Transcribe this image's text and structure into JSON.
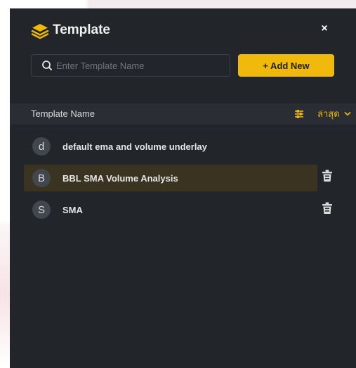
{
  "header": {
    "title": "Template",
    "close_label": "×"
  },
  "search": {
    "placeholder": "Enter Template Name",
    "value": ""
  },
  "add_button": {
    "label": "+ Add New"
  },
  "list_header": {
    "column_title": "Template Name",
    "sort_label": "ล่าสุด"
  },
  "templates": [
    {
      "initial": "d",
      "name": "default ema and volume underlay",
      "selected": false,
      "deletable": false
    },
    {
      "initial": "B",
      "name": "BBL SMA Volume Analysis",
      "selected": true,
      "deletable": true
    },
    {
      "initial": "S",
      "name": "SMA",
      "selected": false,
      "deletable": true
    }
  ],
  "colors": {
    "panel_bg": "#22262b",
    "accent": "#f0b90b",
    "selected_row": "#3a3322",
    "avatar_bg": "#42464d"
  },
  "icons": {
    "logo": "layers-icon",
    "search": "search-icon",
    "sort_toggle": "sliders-icon",
    "sort_dropdown": "chevron-down-icon",
    "delete": "trash-icon",
    "close": "close-icon"
  }
}
